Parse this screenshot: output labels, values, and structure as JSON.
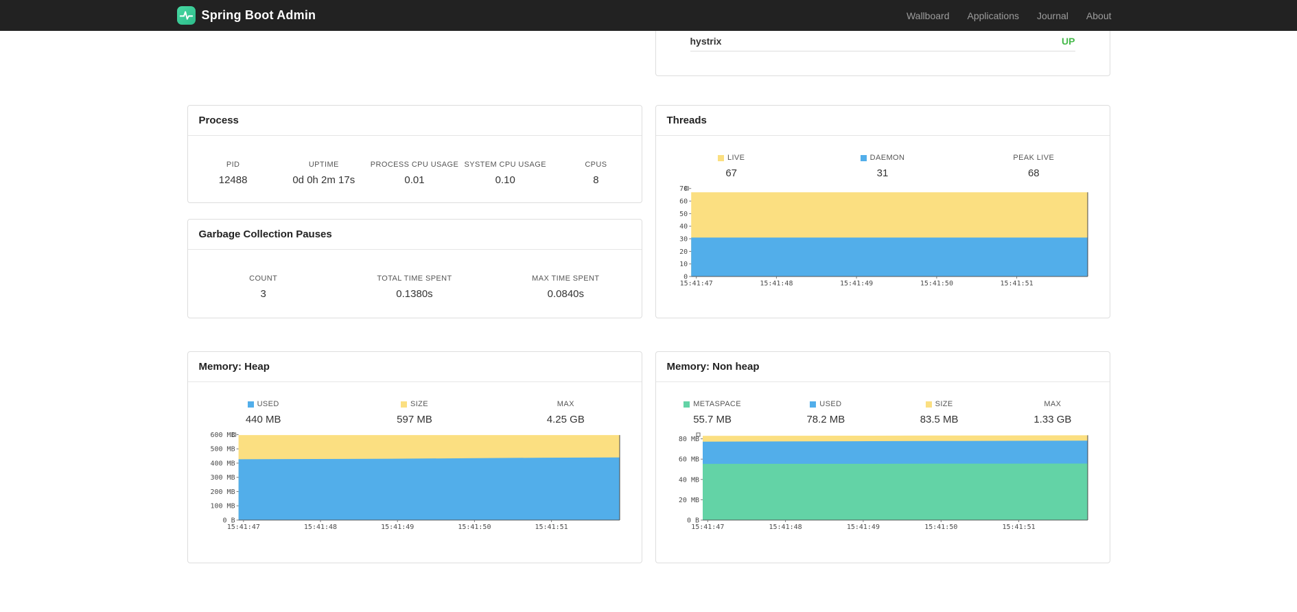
{
  "navbar": {
    "brand": "Spring Boot Admin",
    "items": [
      {
        "label": "Wallboard"
      },
      {
        "label": "Applications"
      },
      {
        "label": "Journal"
      },
      {
        "label": "About"
      }
    ]
  },
  "application": {
    "name": "hystrix",
    "status": "UP",
    "status_color": "#45b94a"
  },
  "process": {
    "title": "Process",
    "stats": [
      {
        "label": "PID",
        "value": "12488"
      },
      {
        "label": "UPTIME",
        "value": "0d 0h 2m 17s"
      },
      {
        "label": "PROCESS CPU USAGE",
        "value": "0.01"
      },
      {
        "label": "SYSTEM CPU USAGE",
        "value": "0.10"
      },
      {
        "label": "CPUS",
        "value": "8"
      }
    ]
  },
  "gc": {
    "title": "Garbage Collection Pauses",
    "stats": [
      {
        "label": "COUNT",
        "value": "3"
      },
      {
        "label": "TOTAL TIME SPENT",
        "value": "0.1380s"
      },
      {
        "label": "MAX TIME SPENT",
        "value": "0.0840s"
      }
    ]
  },
  "threads": {
    "title": "Threads",
    "legend": [
      {
        "label": "LIVE",
        "value": "67"
      },
      {
        "label": "DAEMON",
        "value": "31"
      },
      {
        "label": "PEAK LIVE",
        "value": "68"
      }
    ]
  },
  "heap": {
    "title": "Memory: Heap",
    "legend": [
      {
        "label": "USED",
        "value": "440 MB"
      },
      {
        "label": "SIZE",
        "value": "597 MB"
      },
      {
        "label": "MAX",
        "value": "4.25 GB"
      }
    ]
  },
  "nonheap": {
    "title": "Memory: Non heap",
    "legend": [
      {
        "label": "METASPACE",
        "value": "55.7 MB"
      },
      {
        "label": "USED",
        "value": "78.2 MB"
      },
      {
        "label": "SIZE",
        "value": "83.5 MB"
      },
      {
        "label": "MAX",
        "value": "1.33 GB"
      }
    ]
  },
  "chart_data": [
    {
      "id": "threads",
      "type": "area",
      "x_ticks": [
        "15:41:47",
        "15:41:48",
        "15:41:49",
        "15:41:50",
        "15:41:51"
      ],
      "ylim": [
        0,
        71.5
      ],
      "yticks": [
        {
          "value": 70,
          "label": "70"
        },
        {
          "value": 60,
          "label": "60"
        },
        {
          "value": 50,
          "label": "50"
        },
        {
          "value": 40,
          "label": "40"
        },
        {
          "value": 30,
          "label": "30"
        },
        {
          "value": 20,
          "label": "20"
        },
        {
          "value": 10,
          "label": "10"
        },
        {
          "value": 0,
          "label": "0"
        }
      ],
      "series": [
        {
          "name": "LIVE",
          "color": "#fbdf81",
          "values": [
            67,
            67,
            67,
            67,
            67,
            67
          ]
        },
        {
          "name": "DAEMON",
          "color": "#52aeea",
          "values": [
            31,
            31,
            31,
            31,
            31,
            31
          ]
        }
      ]
    },
    {
      "id": "heap",
      "type": "area",
      "x_ticks": [
        "15:41:47",
        "15:41:48",
        "15:41:49",
        "15:41:50",
        "15:41:51"
      ],
      "ylim": [
        0,
        612
      ],
      "yticks": [
        {
          "value": 600,
          "label": "600 MB"
        },
        {
          "value": 500,
          "label": "500 MB"
        },
        {
          "value": 400,
          "label": "400 MB"
        },
        {
          "value": 300,
          "label": "300 MB"
        },
        {
          "value": 200,
          "label": "200 MB"
        },
        {
          "value": 100,
          "label": "100 MB"
        },
        {
          "value": 0,
          "label": "0 B"
        }
      ],
      "series": [
        {
          "name": "SIZE",
          "color": "#fbdf81",
          "values": [
            597,
            597,
            597,
            597,
            597,
            597
          ]
        },
        {
          "name": "USED",
          "color": "#52aeea",
          "values": [
            427,
            429,
            431,
            434,
            438,
            440
          ]
        }
      ]
    },
    {
      "id": "nonheap",
      "type": "area",
      "x_ticks": [
        "15:41:47",
        "15:41:48",
        "15:41:49",
        "15:41:50",
        "15:41:51"
      ],
      "ylim": [
        0,
        85.8
      ],
      "yticks": [
        {
          "value": 80,
          "label": "80 MB"
        },
        {
          "value": 60,
          "label": "60 MB"
        },
        {
          "value": 40,
          "label": "40 MB"
        },
        {
          "value": 20,
          "label": "20 MB"
        },
        {
          "value": 0,
          "label": "0 B"
        }
      ],
      "series": [
        {
          "name": "SIZE",
          "color": "#fbdf81",
          "values": [
            82.9,
            83.0,
            83.1,
            83.2,
            83.4,
            83.5
          ]
        },
        {
          "name": "USED",
          "color": "#52aeea",
          "values": [
            77.2,
            77.4,
            77.6,
            77.8,
            78.0,
            78.2
          ]
        },
        {
          "name": "METASPACE",
          "color": "#63d3a6",
          "values": [
            55.3,
            55.4,
            55.4,
            55.5,
            55.6,
            55.7
          ]
        }
      ]
    }
  ]
}
